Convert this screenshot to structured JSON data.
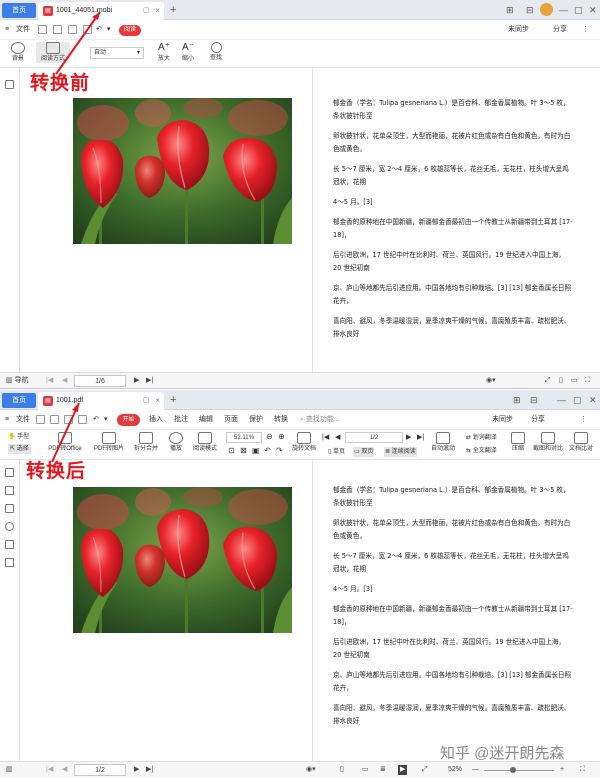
{
  "top": {
    "home_tab": "首页",
    "doc_tab": "1001_44051.mobi",
    "menu": {
      "file": "文件",
      "read_mode": "阅读",
      "sync": "未同步",
      "share": "分享"
    },
    "toolbar": {
      "background": "背景",
      "read_style": "阅读方式",
      "auto": "自动",
      "zoom_in": "放大",
      "zoom_out": "缩小",
      "find": "查找"
    },
    "nav": "导航",
    "page_indicator": "1/6"
  },
  "label_before": "转换前",
  "label_after": "转换后",
  "bottom": {
    "home_tab": "首页",
    "doc_tab": "1001.pdf",
    "menu": {
      "file": "文件",
      "start": "开始",
      "insert": "插入",
      "annotate": "批注",
      "edit": "编辑",
      "page": "页面",
      "protect": "保护",
      "convert": "转换",
      "search": "查找功能...",
      "sync": "未同步",
      "share": "分享"
    },
    "toolbar": {
      "hand": "手型",
      "select": "选择",
      "pdf_to_office": "PDF转Office",
      "pdf_to_image": "PDF转图片",
      "split_merge": "拆分合并",
      "play": "播放",
      "read_mode": "阅读模式",
      "zoom": "52.11%",
      "page": "1/2",
      "rotate": "旋转文档",
      "single": "单页",
      "double": "双页",
      "continuous": "连续阅读",
      "auto_scroll": "自动滚动",
      "translate": "划词翻译",
      "full_translate": "全文翻译",
      "compress": "压缩",
      "screenshot": "截图和对比",
      "doc_compare": "文档比对"
    },
    "page_indicator": "1/2",
    "zoom_pct": "52%"
  },
  "doc": {
    "paragraphs": [
      "郁金香（学名：Tulipa gesneriana L.）是百合科、郁金香属植物。叶 3～5 枚，条状披针形至",
      "卵状披针状，花单朵顶生，大型而艳丽，花被片红色或杂有白色和黄色，有时为白色或黄色，",
      "长 5～7 厘米，宽 2～4 厘米，6 枚雄蕊等长，花丝无毛，无花柱，柱头增大呈鸡冠状，花期",
      "4～5 月。[3]",
      "郁金香的原种地在中国新疆，新疆郁金香最初由一个传教士从新疆带到土耳其 [17-18]，",
      "后引进欧洲，17 世纪中叶在比利时、荷兰、英国风行。19 世纪进入中国上海，20 世纪初南",
      "京、庐山等地都先后引进应用。中国各地均有引种栽培。[3] [13] 郁金香属长日照花卉，",
      "喜向阳、避风，冬季温暖湿润，夏季凉爽干燥的气候。喜腐殖质丰富、疏松肥沃、排水良好"
    ]
  },
  "watermark": "知乎 @迷开朗先森",
  "colors": {
    "accent": "#3b7de9",
    "label": "#e8141d",
    "start_tab": "#e4393c"
  }
}
